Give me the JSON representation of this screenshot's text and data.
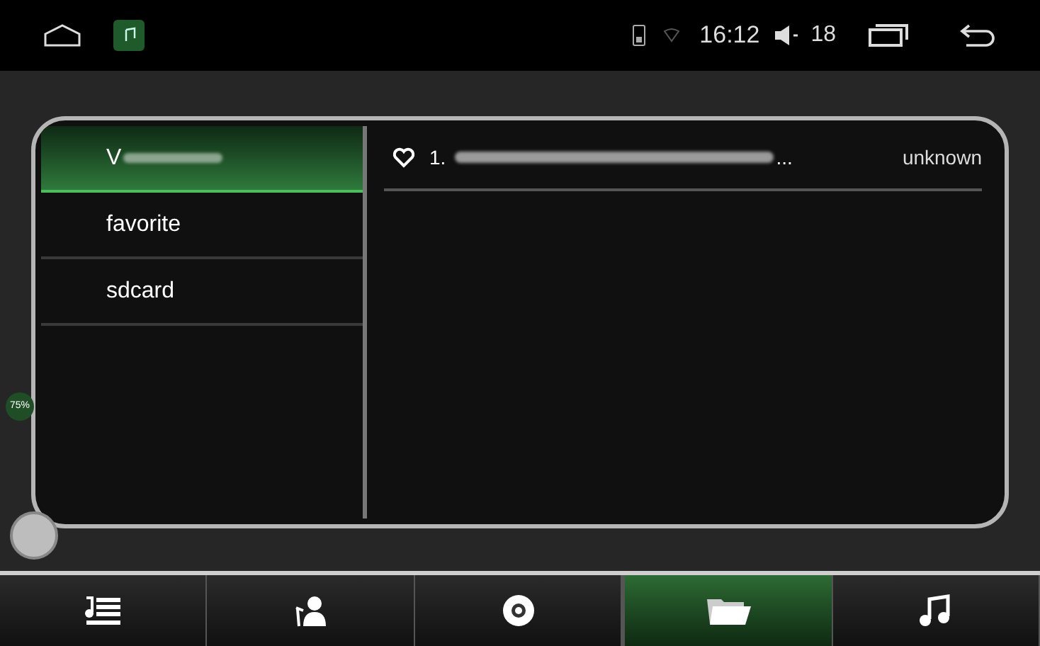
{
  "status_bar": {
    "time": "16:12",
    "volume": "18"
  },
  "folders": [
    {
      "label": "V",
      "selected": true
    },
    {
      "label": "favorite",
      "selected": false
    },
    {
      "label": "sdcard",
      "selected": false
    }
  ],
  "tracks": [
    {
      "number": "1.",
      "ellipsis": "...",
      "artist": "unknown",
      "favorite": false
    }
  ],
  "overlay": {
    "percent": "75%"
  },
  "nav_tabs": [
    {
      "kind": "playlist",
      "selected": false
    },
    {
      "kind": "artist",
      "selected": false
    },
    {
      "kind": "album",
      "selected": false
    },
    {
      "kind": "folder",
      "selected": true
    },
    {
      "kind": "song",
      "selected": false
    }
  ]
}
